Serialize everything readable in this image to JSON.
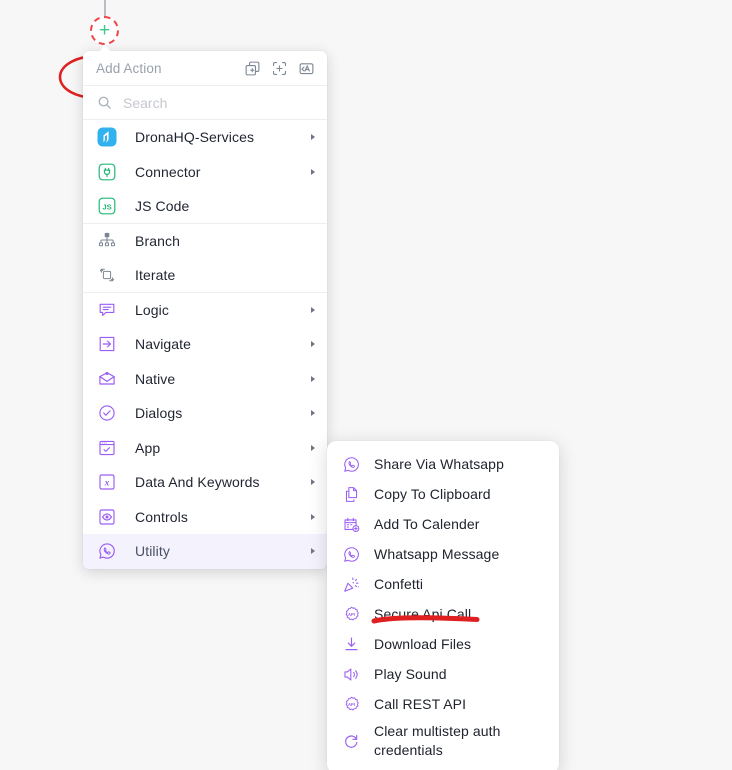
{
  "canvas": {
    "background": "#f7f7f7"
  },
  "node": {
    "add_node_name": "add-step-node",
    "glyph": "+",
    "plus_color": "#3ec98a",
    "ring_color": "#f0464a"
  },
  "annotations": {
    "circle_color": "#e02020",
    "underline_color": "#e02020",
    "underline_target": "Secure Api Call"
  },
  "menu": {
    "title": "Add Action",
    "header_icons": [
      {
        "name": "duplicate-add-icon"
      },
      {
        "name": "add-to-selection-icon"
      },
      {
        "name": "text-annotate-icon"
      }
    ],
    "search": {
      "placeholder": "Search",
      "value": ""
    },
    "items": [
      {
        "label": "DronaHQ-Services",
        "icon": "dronahq-services-icon",
        "arrow": true,
        "divider": false
      },
      {
        "label": "Connector",
        "icon": "connector-plug-icon",
        "arrow": true,
        "divider": false
      },
      {
        "label": "JS Code",
        "icon": "js-code-icon",
        "arrow": false,
        "divider": true
      },
      {
        "label": "Branch",
        "icon": "branch-icon",
        "arrow": false,
        "divider": false
      },
      {
        "label": "Iterate",
        "icon": "iterate-icon",
        "arrow": false,
        "divider": true
      },
      {
        "label": "Logic",
        "icon": "logic-icon",
        "arrow": true,
        "divider": false
      },
      {
        "label": "Navigate",
        "icon": "navigate-icon",
        "arrow": true,
        "divider": false
      },
      {
        "label": "Native",
        "icon": "native-mail-icon",
        "arrow": true,
        "divider": false
      },
      {
        "label": "Dialogs",
        "icon": "dialogs-check-icon",
        "arrow": true,
        "divider": false
      },
      {
        "label": "App",
        "icon": "app-window-icon",
        "arrow": true,
        "divider": false
      },
      {
        "label": "Data And Keywords",
        "icon": "data-keywords-x-icon",
        "arrow": true,
        "divider": false
      },
      {
        "label": "Controls",
        "icon": "controls-eye-icon",
        "arrow": true,
        "divider": false
      },
      {
        "label": "Utility",
        "icon": "utility-whatsapp-icon",
        "arrow": true,
        "divider": false,
        "active": true
      }
    ]
  },
  "submenu": {
    "items": [
      {
        "label": "Share Via Whatsapp",
        "icon": "whatsapp-icon"
      },
      {
        "label": "Copy To Clipboard",
        "icon": "copy-icon"
      },
      {
        "label": "Add To Calender",
        "icon": "calendar-add-icon"
      },
      {
        "label": "Whatsapp Message",
        "icon": "whatsapp-icon"
      },
      {
        "label": "Confetti",
        "icon": "confetti-icon"
      },
      {
        "label": "Secure Api Call",
        "icon": "api-badge-icon"
      },
      {
        "label": "Download Files",
        "icon": "download-icon"
      },
      {
        "label": "Play Sound",
        "icon": "speaker-icon"
      },
      {
        "label": "Call REST API",
        "icon": "api-badge-icon"
      },
      {
        "label": "Clear multistep auth credentials",
        "icon": "refresh-icon",
        "two_line": true
      }
    ]
  }
}
